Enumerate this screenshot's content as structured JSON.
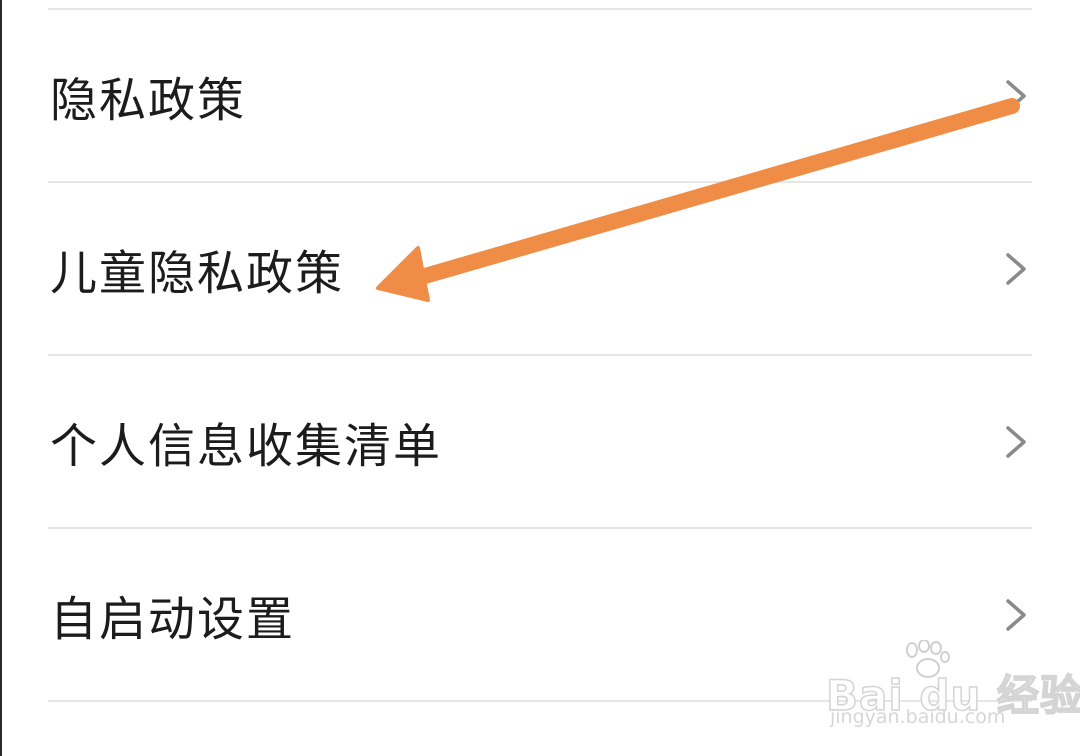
{
  "settings_list": {
    "items": [
      {
        "label": "隐私政策",
        "icon": "chevron-right-icon"
      },
      {
        "label": "儿童隐私政策",
        "icon": "chevron-right-icon"
      },
      {
        "label": "个人信息收集清单",
        "icon": "chevron-right-icon"
      },
      {
        "label": "自启动设置",
        "icon": "chevron-right-icon"
      }
    ]
  },
  "annotation": {
    "type": "arrow",
    "color": "#ef8c45",
    "points_to": "儿童隐私政策"
  },
  "watermark": {
    "brand": "Bai du 经验",
    "url": "jingyan.baidu.com",
    "icon": "paw-icon"
  },
  "colors": {
    "text": "#1c1c1c",
    "divider": "#e6e6e6",
    "chevron": "#8a8a8a",
    "arrow": "#ef8c45"
  }
}
